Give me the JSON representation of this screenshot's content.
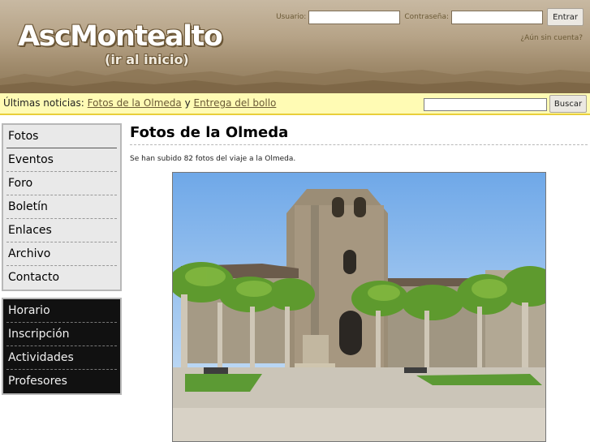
{
  "header": {
    "site_title": "AscMontealto",
    "home_link": "(ir al inicio)",
    "user_label": "Usuario:",
    "password_label": "Contraseña:",
    "login_button": "Entrar",
    "register_link": "¿Aún sin cuenta?"
  },
  "newsbar": {
    "prefix": "Últimas noticias:",
    "link1": "Fotos de la Olmeda",
    "joiner": "y",
    "link2": "Entrega del bollo",
    "search_button": "Buscar"
  },
  "sidebar": {
    "main_menu": [
      "Fotos",
      "Eventos",
      "Foro",
      "Boletín",
      "Enlaces",
      "Archivo",
      "Contacto"
    ],
    "school_menu": [
      "Horario",
      "Inscripción",
      "Actividades",
      "Profesores"
    ]
  },
  "main": {
    "title": "Fotos de la Olmeda",
    "body": "Se han subido 82 fotos del viaje a la Olmeda."
  },
  "colors": {
    "news_bg": "#fffbb4",
    "news_border": "#e9cf3a",
    "dark_menu_bg": "#111111",
    "light_menu_bg": "#e9e9e9",
    "link": "#6b5a36"
  }
}
